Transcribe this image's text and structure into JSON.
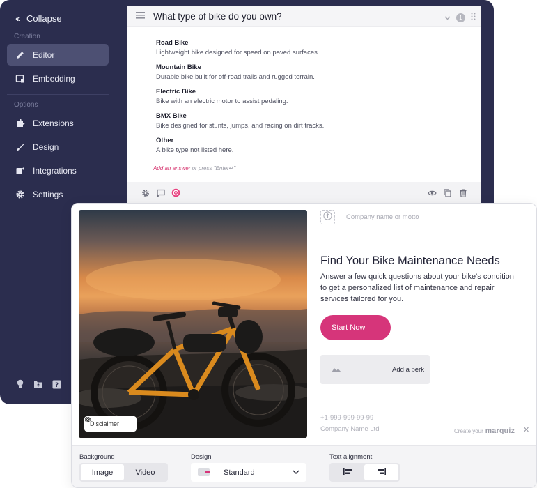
{
  "sidebar": {
    "collapse_label": "Collapse",
    "section_creation": "Creation",
    "section_options": "Options",
    "items": [
      {
        "label": "Editor",
        "icon": "pencil-icon",
        "active": true
      },
      {
        "label": "Embedding",
        "icon": "embed-icon",
        "active": false
      },
      {
        "label": "Extensions",
        "icon": "puzzle-icon",
        "active": false
      },
      {
        "label": "Design",
        "icon": "brush-icon",
        "active": false
      },
      {
        "label": "Integrations",
        "icon": "integrations-icon",
        "active": false
      },
      {
        "label": "Settings",
        "icon": "gear-icon",
        "active": false
      }
    ],
    "bottom_icons": [
      "lightbulb-icon",
      "folder-upload-icon",
      "help-icon"
    ]
  },
  "question": {
    "title": "What type of bike do you own?",
    "number": "1",
    "answers": [
      {
        "title": "Road Bike",
        "desc": "Lightweight bike designed for speed on paved surfaces."
      },
      {
        "title": "Mountain Bike",
        "desc": "Durable bike built for off-road trails and rugged terrain."
      },
      {
        "title": "Electric Bike",
        "desc": "Bike with an electric motor to assist pedaling."
      },
      {
        "title": "BMX Bike",
        "desc": "Bike designed for stunts, jumps, and racing on dirt tracks."
      },
      {
        "title": "Other",
        "desc": "A bike type not listed here."
      }
    ],
    "add_answer_link": "Add an answer",
    "add_answer_hint": " or press \"Enter↵\""
  },
  "preview": {
    "disclaimer": "Disclaimer",
    "motto_placeholder": "Company name or motto",
    "headline": "Find Your Bike Maintenance Needs",
    "subtext": "Answer a few quick questions about your bike's condition to get a personalized list of maintenance and repair services tailored for you.",
    "start_button": "Start Now",
    "perk_label": "Add a perk",
    "phone": "+1-999-999-99-99",
    "company": "Company Name Ltd",
    "create_your": "Create your",
    "brand": "marquiz",
    "accent_color": "#d6357a"
  },
  "settings": {
    "background_label": "Background",
    "background_options": [
      "Image",
      "Video"
    ],
    "background_selected": "Image",
    "design_label": "Design",
    "design_value": "Standard",
    "text_alignment_label": "Text alignment",
    "alignment_selected": "right"
  }
}
